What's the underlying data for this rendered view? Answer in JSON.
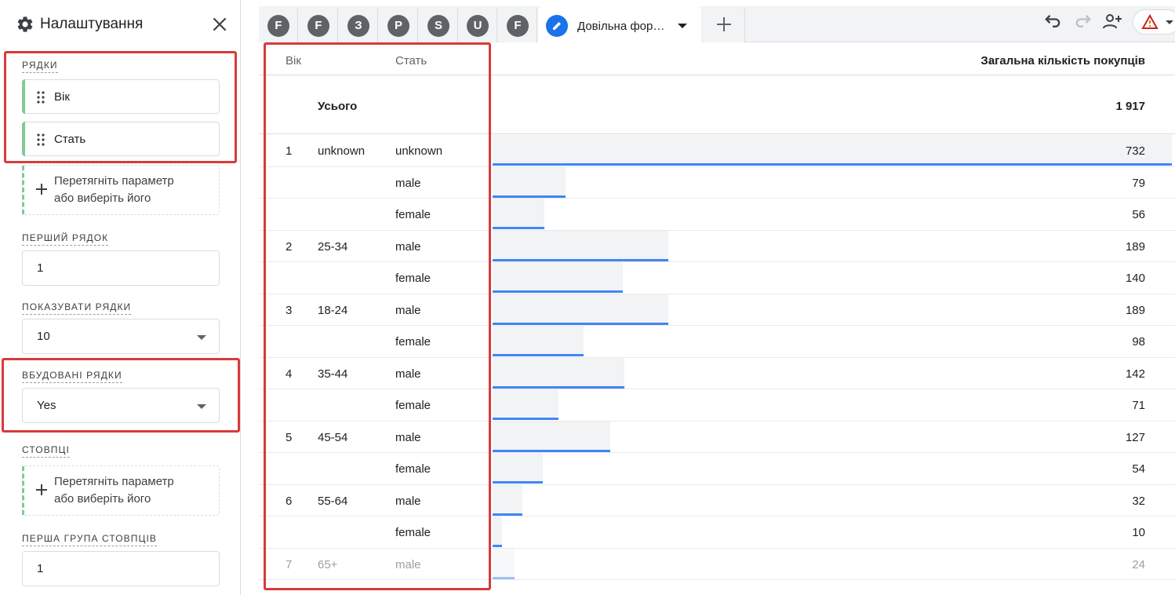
{
  "sidebar": {
    "title": "Налаштування",
    "rows_label": "Рядки",
    "rows_chips": [
      "Вік",
      "Стать"
    ],
    "dropzone_text_1": "Перетягніть параметр",
    "dropzone_text_2": "або виберіть його",
    "first_row_label": "Перший рядок",
    "first_row_value": "1",
    "show_rows_label": "Показувати рядки",
    "show_rows_value": "10",
    "nested_rows_label": "Вбудовані рядки",
    "nested_rows_value": "Yes",
    "columns_label": "Стовпці",
    "columns_dropzone_1": "Перетягніть параметр",
    "columns_dropzone_2": "або виберіть його",
    "first_col_group_label": "Перша група стовпців",
    "first_col_group_value": "1"
  },
  "tabs": {
    "letters": [
      "F",
      "F",
      "З",
      "P",
      "S",
      "U",
      "F"
    ],
    "active_name": "Довільна фор…"
  },
  "table": {
    "col_age": "Вік",
    "col_gender": "Стать",
    "col_metric": "Загальна кількість покупців",
    "sort_arrow": "↓",
    "total_label": "Усього",
    "total_value": "1 917",
    "max_value": 732,
    "rows": [
      {
        "idx": "1",
        "age": "unknown",
        "gender": "unknown",
        "value": 732
      },
      {
        "idx": "",
        "age": "",
        "gender": "male",
        "value": 79
      },
      {
        "idx": "",
        "age": "",
        "gender": "female",
        "value": 56
      },
      {
        "idx": "2",
        "age": "25-34",
        "gender": "male",
        "value": 189
      },
      {
        "idx": "",
        "age": "",
        "gender": "female",
        "value": 140
      },
      {
        "idx": "3",
        "age": "18-24",
        "gender": "male",
        "value": 189
      },
      {
        "idx": "",
        "age": "",
        "gender": "female",
        "value": 98
      },
      {
        "idx": "4",
        "age": "35-44",
        "gender": "male",
        "value": 142
      },
      {
        "idx": "",
        "age": "",
        "gender": "female",
        "value": 71
      },
      {
        "idx": "5",
        "age": "45-54",
        "gender": "male",
        "value": 127
      },
      {
        "idx": "",
        "age": "",
        "gender": "female",
        "value": 54
      },
      {
        "idx": "6",
        "age": "55-64",
        "gender": "male",
        "value": 32
      },
      {
        "idx": "",
        "age": "",
        "gender": "female",
        "value": 10
      },
      {
        "idx": "7",
        "age": "65+",
        "gender": "male",
        "value": 24
      }
    ]
  },
  "colors": {
    "accent": "#1a73e8",
    "bar_line": "#4285f4",
    "highlight_box": "#d93a3a",
    "chip_stripe": "#81c995"
  }
}
